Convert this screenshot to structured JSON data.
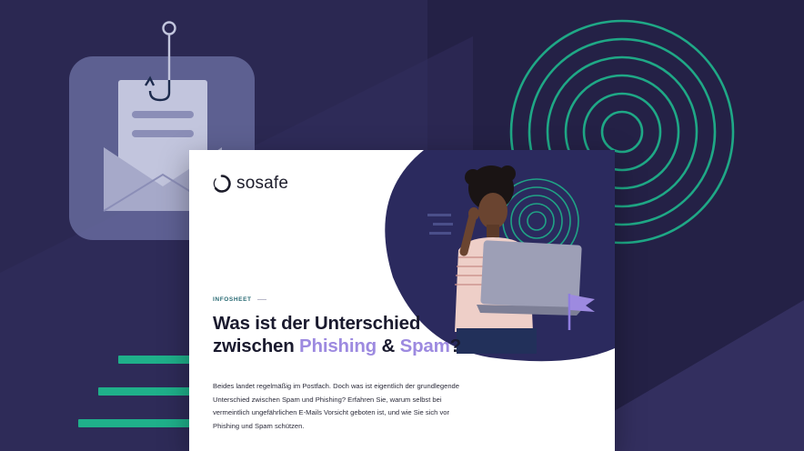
{
  "brand": {
    "name": "sosafe"
  },
  "document": {
    "eyebrow": "INFOSHEET",
    "title": {
      "line1": "Was ist der Unterschied",
      "line2_pre": "zwischen ",
      "highlight1": "Phishing",
      "connector": " & ",
      "highlight2": "Spam",
      "end": "?"
    },
    "body": "Beides landet regelmäßig im Postfach. Doch was ist eigentlich der grundlegende Unterschied zwischen Spam und Phishing? Erfahren Sie, warum selbst bei vermeintlich ungefährlichen E-Mails Vorsicht geboten ist, und wie Sie sich vor Phishing und Spam schützen."
  },
  "icons": [
    "phishing-hook-icon",
    "envelope-icon",
    "concentric-rings-decoration",
    "flag-icon",
    "laptop-icon",
    "person-illustration"
  ],
  "colors": {
    "background": "#2b2852",
    "background_dark": "#1f1c40",
    "accent_green": "#1fb08a",
    "accent_purple": "#9d8ae0",
    "eyebrow_teal": "#2a6b74",
    "text_dark": "#1a1a2e"
  }
}
